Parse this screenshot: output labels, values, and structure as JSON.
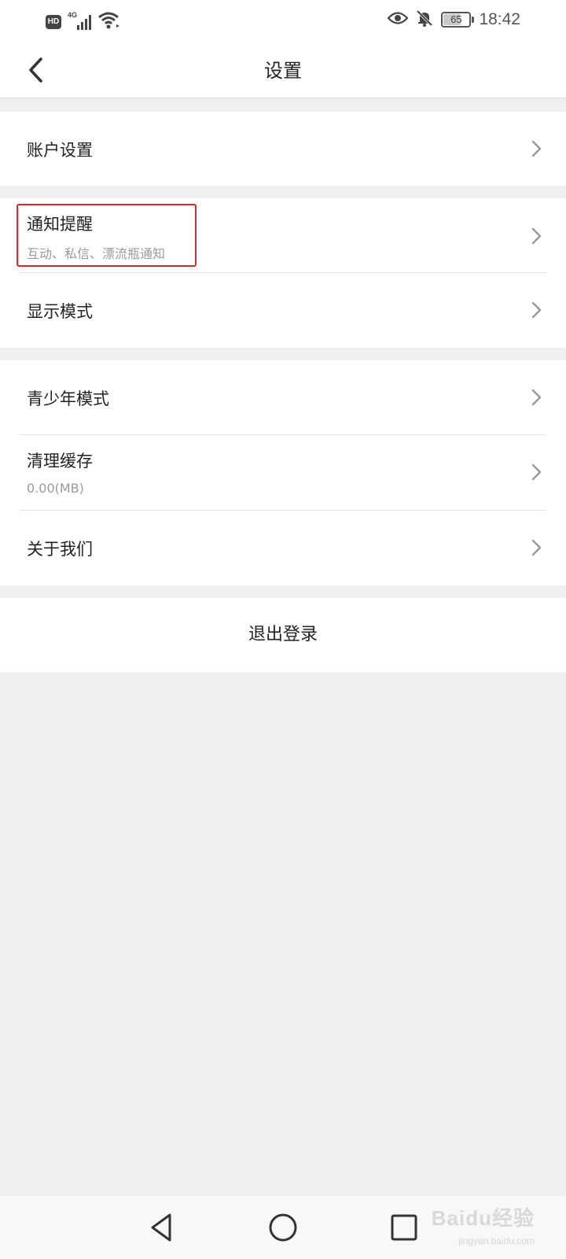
{
  "status_bar": {
    "hd_label": "HD",
    "network_label": "4G",
    "battery_level": "65",
    "time": "18:42"
  },
  "header": {
    "title": "设置"
  },
  "groups": [
    {
      "items": [
        {
          "label": "账户设置"
        }
      ]
    },
    {
      "items": [
        {
          "label": "通知提醒",
          "subtitle": "互动、私信、漂流瓶通知"
        },
        {
          "label": "显示模式"
        }
      ]
    },
    {
      "items": [
        {
          "label": "青少年模式"
        },
        {
          "label": "清理缓存",
          "subtitle": "0.00(MB)"
        },
        {
          "label": "关于我们"
        }
      ]
    }
  ],
  "logout": {
    "label": "退出登录"
  },
  "watermark": {
    "text": "Baidu经验",
    "sub": "jingyan.baidu.com"
  },
  "colors": {
    "background": "#f0f0f0",
    "surface": "#ffffff",
    "highlight": "#d42a2a",
    "subtext": "#9a9a9a"
  }
}
